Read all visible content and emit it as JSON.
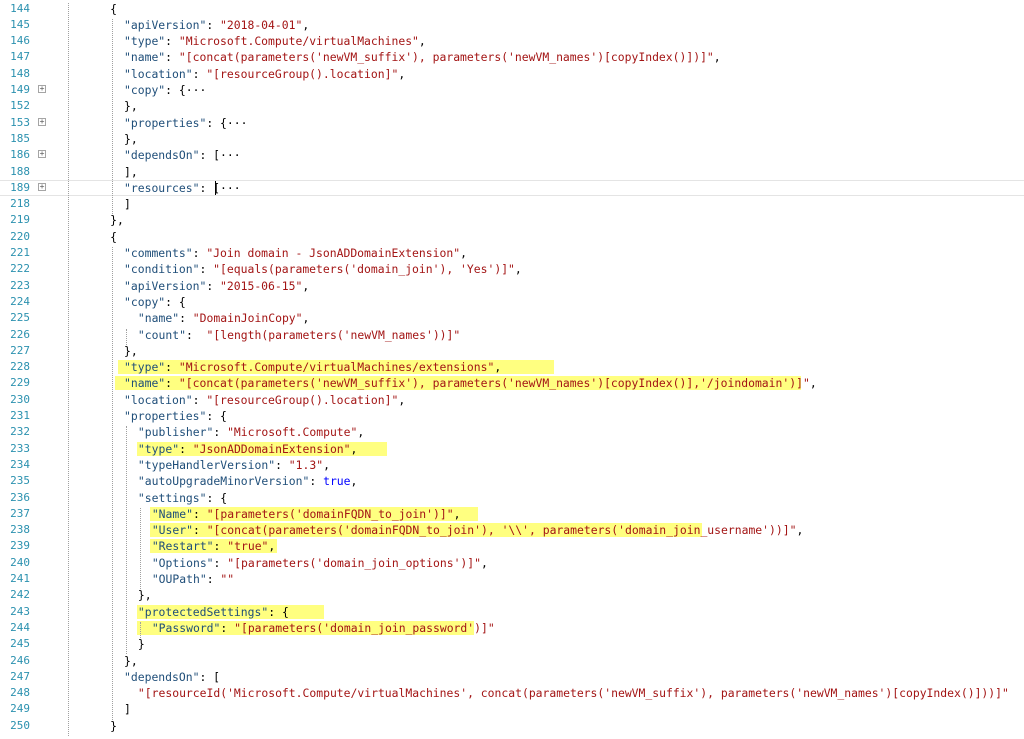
{
  "lines": [
    {
      "n": "144",
      "i": 7.5,
      "fold": false,
      "t": [
        [
          "p",
          "{"
        ]
      ]
    },
    {
      "n": "145",
      "i": 9.5,
      "fold": false,
      "t": [
        [
          "key",
          "\"apiVersion\""
        ],
        [
          "p",
          ": "
        ],
        [
          "s",
          "\"2018-04-01\""
        ],
        [
          "p",
          ","
        ]
      ]
    },
    {
      "n": "146",
      "i": 9.5,
      "fold": false,
      "t": [
        [
          "key",
          "\"type\""
        ],
        [
          "p",
          ": "
        ],
        [
          "s",
          "\"Microsoft.Compute/virtualMachines\""
        ],
        [
          "p",
          ","
        ]
      ]
    },
    {
      "n": "147",
      "i": 9.5,
      "fold": false,
      "t": [
        [
          "key",
          "\"name\""
        ],
        [
          "p",
          ": "
        ],
        [
          "s",
          "\"[concat(parameters('newVM_suffix'), parameters('newVM_names')[copyIndex()])]\""
        ],
        [
          "p",
          ","
        ]
      ]
    },
    {
      "n": "148",
      "i": 9.5,
      "fold": false,
      "t": [
        [
          "key",
          "\"location\""
        ],
        [
          "p",
          ": "
        ],
        [
          "s",
          "\"[resourceGroup().location]\""
        ],
        [
          "p",
          ","
        ]
      ]
    },
    {
      "n": "149",
      "i": 9.5,
      "fold": true,
      "t": [
        [
          "key",
          "\"copy\""
        ],
        [
          "p",
          ": {"
        ],
        [
          "p",
          "···"
        ]
      ]
    },
    {
      "n": "152",
      "i": 9.5,
      "fold": false,
      "t": [
        [
          "p",
          "},"
        ]
      ]
    },
    {
      "n": "153",
      "i": 9.5,
      "fold": true,
      "t": [
        [
          "key",
          "\"properties\""
        ],
        [
          "p",
          ": {"
        ],
        [
          "p",
          "···"
        ]
      ]
    },
    {
      "n": "185",
      "i": 9.5,
      "fold": false,
      "t": [
        [
          "p",
          "},"
        ]
      ]
    },
    {
      "n": "186",
      "i": 9.5,
      "fold": true,
      "t": [
        [
          "key",
          "\"dependsOn\""
        ],
        [
          "p",
          ": ["
        ],
        [
          "p",
          "···"
        ]
      ]
    },
    {
      "n": "188",
      "i": 9.5,
      "fold": false,
      "t": [
        [
          "p",
          "],"
        ]
      ]
    },
    {
      "n": "189",
      "i": 9.5,
      "fold": true,
      "current": true,
      "t": [
        [
          "key",
          "\"resources\""
        ],
        [
          "p",
          ": ["
        ],
        [
          "p",
          "···"
        ]
      ]
    },
    {
      "n": "218",
      "i": 9.5,
      "fold": false,
      "t": [
        [
          "p",
          "]"
        ]
      ]
    },
    {
      "n": "219",
      "i": 7.5,
      "fold": false,
      "t": [
        [
          "p",
          "},"
        ]
      ]
    },
    {
      "n": "220",
      "i": 7.5,
      "fold": false,
      "t": [
        [
          "p",
          "{"
        ]
      ]
    },
    {
      "n": "221",
      "i": 9.5,
      "fold": false,
      "t": [
        [
          "key",
          "\"comments\""
        ],
        [
          "p",
          ": "
        ],
        [
          "s",
          "\"Join domain - JsonADDomainExtension\""
        ],
        [
          "p",
          ","
        ]
      ]
    },
    {
      "n": "222",
      "i": 9.5,
      "fold": false,
      "t": [
        [
          "key",
          "\"condition\""
        ],
        [
          "p",
          ": "
        ],
        [
          "s",
          "\"[equals(parameters('domain_join'), 'Yes')]\""
        ],
        [
          "p",
          ","
        ]
      ]
    },
    {
      "n": "223",
      "i": 9.5,
      "fold": false,
      "t": [
        [
          "key",
          "\"apiVersion\""
        ],
        [
          "p",
          ": "
        ],
        [
          "s",
          "\"2015-06-15\""
        ],
        [
          "p",
          ","
        ]
      ]
    },
    {
      "n": "224",
      "i": 9.5,
      "fold": false,
      "t": [
        [
          "key",
          "\"copy\""
        ],
        [
          "p",
          ": {"
        ]
      ]
    },
    {
      "n": "225",
      "i": 11.5,
      "fold": false,
      "t": [
        [
          "key",
          "\"name\""
        ],
        [
          "p",
          ": "
        ],
        [
          "s",
          "\"DomainJoinCopy\""
        ],
        [
          "p",
          ","
        ]
      ]
    },
    {
      "n": "226",
      "i": 11.5,
      "fold": false,
      "t": [
        [
          "key",
          "\"count\""
        ],
        [
          "p",
          ":  "
        ],
        [
          "s",
          "\"[length(parameters('newVM_names'))]\""
        ]
      ]
    },
    {
      "n": "227",
      "i": 9.5,
      "fold": false,
      "t": [
        [
          "p",
          "},"
        ]
      ]
    },
    {
      "n": "228",
      "i": 9.5,
      "fold": false,
      "hl": [
        -0.8,
        62.6
      ],
      "t": [
        [
          "key",
          "\"type\""
        ],
        [
          "p",
          ": "
        ],
        [
          "s",
          "\"Microsoft.Compute/virtualMachines/extensions\""
        ],
        [
          "p",
          ","
        ]
      ]
    },
    {
      "n": "229",
      "i": 9.5,
      "fold": false,
      "hl": [
        -1.3,
        98.7
      ],
      "t": [
        [
          "key",
          "\"name\""
        ],
        [
          "p",
          ": "
        ],
        [
          "s",
          "\"[concat(parameters('newVM_suffix'), parameters('newVM_names')[copyIndex()],'/joindomain')]\""
        ],
        [
          "p",
          ","
        ]
      ]
    },
    {
      "n": "230",
      "i": 9.5,
      "fold": false,
      "t": [
        [
          "key",
          "\"location\""
        ],
        [
          "p",
          ": "
        ],
        [
          "s",
          "\"[resourceGroup().location]\""
        ],
        [
          "p",
          ","
        ]
      ]
    },
    {
      "n": "231",
      "i": 9.5,
      "fold": false,
      "t": [
        [
          "key",
          "\"properties\""
        ],
        [
          "p",
          ": {"
        ]
      ]
    },
    {
      "n": "232",
      "i": 11.5,
      "fold": false,
      "t": [
        [
          "key",
          "\"publisher\""
        ],
        [
          "p",
          ": "
        ],
        [
          "s",
          "\"Microsoft.Compute\""
        ],
        [
          "p",
          ","
        ]
      ]
    },
    {
      "n": "233",
      "i": 11.5,
      "fold": false,
      "hl": [
        -0.2,
        36.1
      ],
      "t": [
        [
          "key",
          "\"type\""
        ],
        [
          "p",
          ": "
        ],
        [
          "s",
          "\"JsonADDomainExtension\""
        ],
        [
          "p",
          ","
        ]
      ]
    },
    {
      "n": "234",
      "i": 11.5,
      "fold": false,
      "t": [
        [
          "key",
          "\"typeHandlerVersion\""
        ],
        [
          "p",
          ": "
        ],
        [
          "s",
          "\"1.3\""
        ],
        [
          "p",
          ","
        ]
      ]
    },
    {
      "n": "235",
      "i": 11.5,
      "fold": false,
      "t": [
        [
          "key",
          "\"autoUpgradeMinorVersion\""
        ],
        [
          "p",
          ": "
        ],
        [
          "b",
          "true"
        ],
        [
          "p",
          ","
        ]
      ]
    },
    {
      "n": "236",
      "i": 11.5,
      "fold": false,
      "t": [
        [
          "key",
          "\"settings\""
        ],
        [
          "p",
          ": {"
        ]
      ]
    },
    {
      "n": "237",
      "i": 13.5,
      "fold": false,
      "hl": [
        -0.3,
        47.3
      ],
      "t": [
        [
          "key",
          "\"Name\""
        ],
        [
          "p",
          ": "
        ],
        [
          "s",
          "\"[parameters('domainFQDN_to_join')]\""
        ],
        [
          "p",
          ","
        ]
      ]
    },
    {
      "n": "238",
      "i": 13.5,
      "fold": false,
      "hl": [
        -0.3,
        79.4
      ],
      "t": [
        [
          "key",
          "\"User\""
        ],
        [
          "p",
          ": "
        ],
        [
          "s",
          "\"[concat(parameters('domainFQDN_to_join'), '\\\\', parameters('domain_join_username'))]\""
        ],
        [
          "p",
          ","
        ]
      ]
    },
    {
      "n": "239",
      "i": 13.5,
      "fold": false,
      "hl": [
        -0.3,
        18.3
      ],
      "t": [
        [
          "key",
          "\"Restart\""
        ],
        [
          "p",
          ": "
        ],
        [
          "s",
          "\"true\""
        ],
        [
          "p",
          ","
        ]
      ]
    },
    {
      "n": "240",
      "i": 13.5,
      "fold": false,
      "t": [
        [
          "key",
          "\"Options\""
        ],
        [
          "p",
          ": "
        ],
        [
          "s",
          "\"[parameters('domain_join_options')]\""
        ],
        [
          "p",
          ","
        ]
      ]
    },
    {
      "n": "241",
      "i": 13.5,
      "fold": false,
      "t": [
        [
          "key",
          "\"OUPath\""
        ],
        [
          "p",
          ": "
        ],
        [
          "s",
          "\"\""
        ]
      ]
    },
    {
      "n": "242",
      "i": 11.5,
      "fold": false,
      "t": [
        [
          "p",
          "},"
        ]
      ]
    },
    {
      "n": "243",
      "i": 11.5,
      "fold": false,
      "hl": [
        -0.2,
        27
      ],
      "t": [
        [
          "key",
          "\"protectedSettings\""
        ],
        [
          "p",
          ": {"
        ]
      ]
    },
    {
      "n": "244",
      "i": 13.5,
      "fold": false,
      "hl": [
        -2.2,
        48.5
      ],
      "t": [
        [
          "key",
          "\"Password\""
        ],
        [
          "p",
          ": "
        ],
        [
          "s",
          "\"[parameters('domain_join_password')]\""
        ]
      ]
    },
    {
      "n": "245",
      "i": 11.5,
      "fold": false,
      "t": [
        [
          "p",
          "}"
        ]
      ]
    },
    {
      "n": "246",
      "i": 9.5,
      "fold": false,
      "t": [
        [
          "p",
          "},"
        ]
      ]
    },
    {
      "n": "247",
      "i": 9.5,
      "fold": false,
      "t": [
        [
          "key",
          "\"dependsOn\""
        ],
        [
          "p",
          ": ["
        ]
      ]
    },
    {
      "n": "248",
      "i": 11.5,
      "fold": false,
      "t": [
        [
          "s",
          "\"[resourceId('Microsoft.Compute/virtualMachines', concat(parameters('newVM_suffix'), parameters('newVM_names')[copyIndex()]))]\""
        ]
      ]
    },
    {
      "n": "249",
      "i": 9.5,
      "fold": false,
      "t": [
        [
          "p",
          "]"
        ]
      ]
    },
    {
      "n": "250",
      "i": 7.5,
      "fold": false,
      "t": [
        [
          "p",
          "}"
        ]
      ]
    }
  ]
}
